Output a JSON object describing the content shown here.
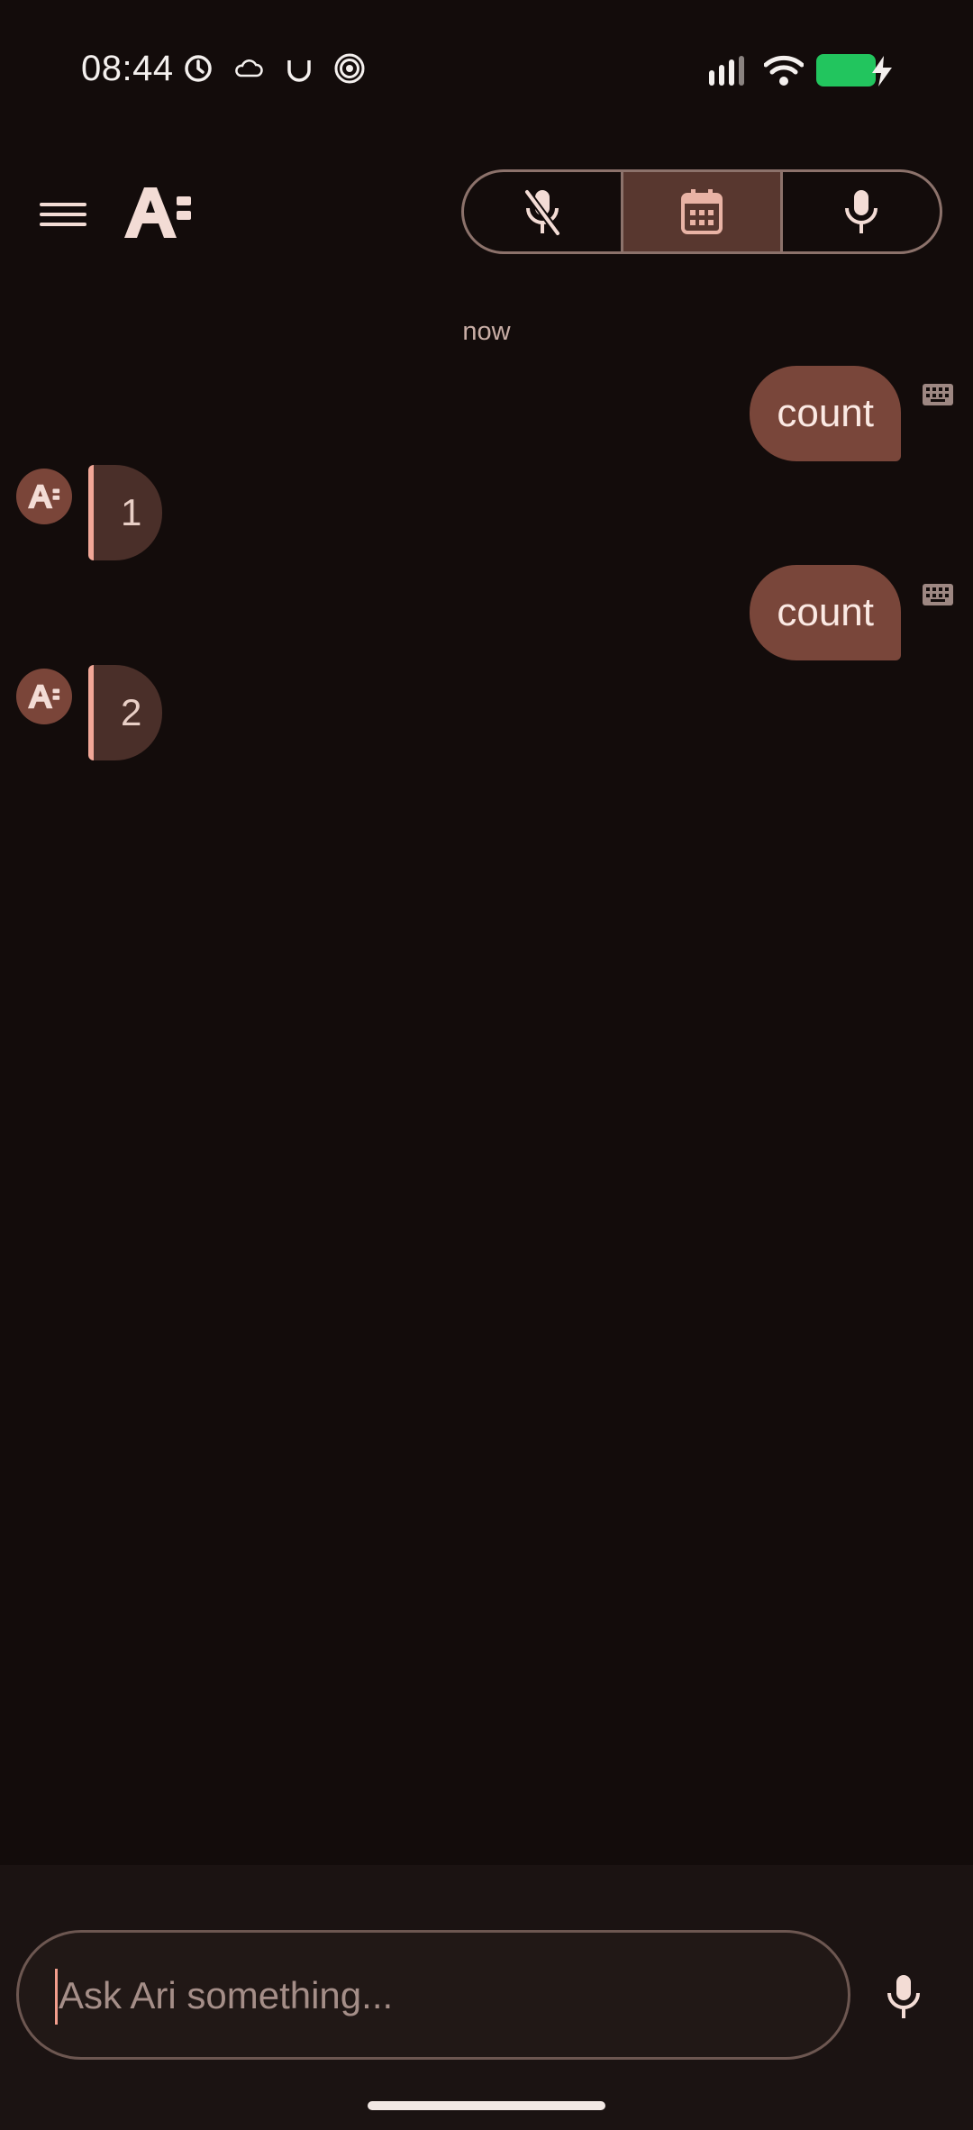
{
  "status_bar": {
    "time": "08:44",
    "icons": [
      "alarm-icon",
      "cloud-icon",
      "u-icon",
      "spiral-icon",
      "signal-icon",
      "wifi-icon",
      "battery-charging-icon"
    ],
    "battery_color": "#22c55e"
  },
  "header": {
    "menu_icon": "hamburger-icon",
    "logo_icon": "ari-logo-icon",
    "mode_switch": [
      {
        "name": "mic-off-icon",
        "active": false
      },
      {
        "name": "calendar-icon",
        "active": true
      },
      {
        "name": "mic-icon",
        "active": false
      }
    ]
  },
  "chat": {
    "timestamp": "now",
    "messages": [
      {
        "role": "user",
        "text": "count",
        "input_icon": "keyboard-icon"
      },
      {
        "role": "assistant",
        "text": "1"
      },
      {
        "role": "user",
        "text": "count",
        "input_icon": "keyboard-icon"
      },
      {
        "role": "assistant",
        "text": "2"
      }
    ]
  },
  "composer": {
    "placeholder": "Ask Ari something...",
    "mic_icon": "mic-icon"
  },
  "colors": {
    "background": "#130c0b",
    "user_bubble": "#79463a",
    "assistant_bubble": "#4a2f29",
    "accent": "#f2a797"
  }
}
